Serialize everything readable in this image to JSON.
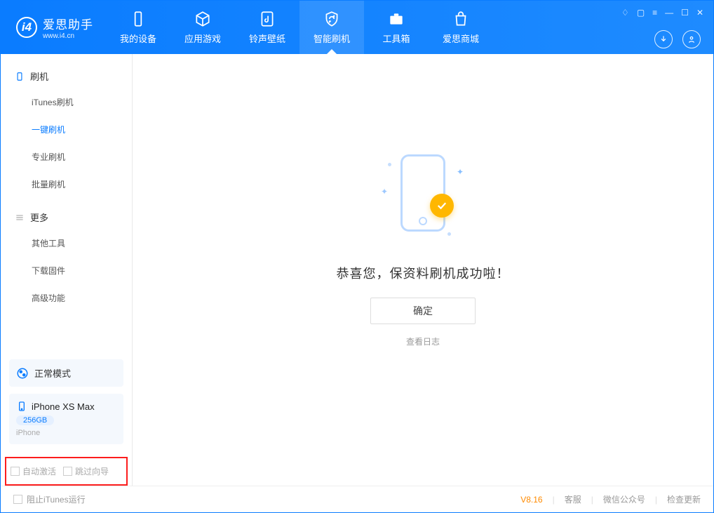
{
  "app": {
    "title": "爱思助手",
    "subtitle": "www.i4.cn"
  },
  "nav": {
    "items": [
      {
        "label": "我的设备"
      },
      {
        "label": "应用游戏"
      },
      {
        "label": "铃声壁纸"
      },
      {
        "label": "智能刷机"
      },
      {
        "label": "工具箱"
      },
      {
        "label": "爱思商城"
      }
    ],
    "active_index": 3
  },
  "sidebar": {
    "group1": {
      "title": "刷机",
      "items": [
        {
          "label": "iTunes刷机"
        },
        {
          "label": "一键刷机"
        },
        {
          "label": "专业刷机"
        },
        {
          "label": "批量刷机"
        }
      ],
      "active_index": 1
    },
    "group2": {
      "title": "更多",
      "items": [
        {
          "label": "其他工具"
        },
        {
          "label": "下载固件"
        },
        {
          "label": "高级功能"
        }
      ]
    },
    "mode": "正常模式",
    "device": {
      "name": "iPhone XS Max",
      "storage": "256GB",
      "type": "iPhone"
    },
    "options": {
      "auto_activate": "自动激活",
      "skip_guide": "跳过向导"
    }
  },
  "content": {
    "success_message": "恭喜您，保资料刷机成功啦！",
    "ok_label": "确定",
    "log_link": "查看日志"
  },
  "footer": {
    "block_itunes": "阻止iTunes运行",
    "version": "V8.16",
    "links": {
      "service": "客服",
      "wechat": "微信公众号",
      "update": "检查更新"
    }
  }
}
